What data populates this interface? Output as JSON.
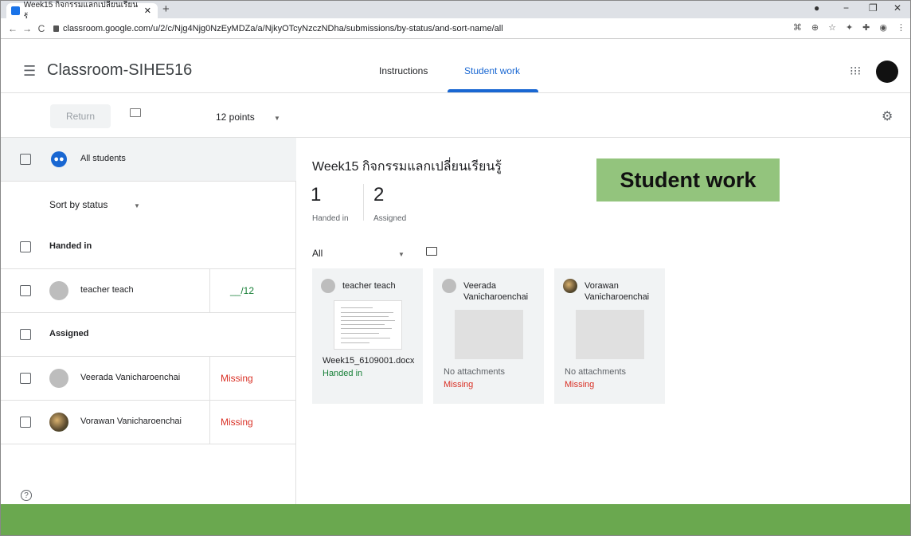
{
  "browser": {
    "tab_title": "Week15 กิจกรรมแลกเปลี่ยนเรียนรู้",
    "url": "classroom.google.com/u/2/c/Njg4Njg0NzEyMDZa/a/NjkyOTcyNzczNDha/submissions/by-status/and-sort-name/all"
  },
  "appbar": {
    "class_name": "Classroom-SIHE516",
    "tabs": [
      "Instructions",
      "Student work"
    ],
    "active_tab": "Student work"
  },
  "toolbar": {
    "return_label": "Return",
    "points": "12 points"
  },
  "roster": {
    "all_students": "All students",
    "sort_label": "Sort by status",
    "handed_in_header": "Handed in",
    "assigned_header": "Assigned",
    "students": [
      {
        "name": "teacher teach",
        "status": "__/12"
      },
      {
        "name": "Veerada Vanicharoenchai",
        "status": "Missing"
      },
      {
        "name": "Vorawan Vanicharoenchai",
        "status": "Missing"
      }
    ]
  },
  "assignment": {
    "title": "Week15 กิจกรรมแลกเปลี่ยนเรียนรู้",
    "handed_in_count": "1",
    "handed_in_label": "Handed in",
    "assigned_count": "2",
    "assigned_label": "Assigned",
    "filter": "All"
  },
  "cards": [
    {
      "name": "teacher teach",
      "file": "Week15_6109001.docx",
      "status": "Handed in"
    },
    {
      "name_line1": "Veerada",
      "name_line2": "Vanicharoenchai",
      "file": "No attachments",
      "status": "Missing"
    },
    {
      "name_line1": "Vorawan",
      "name_line2": "Vanicharoenchai",
      "file": "No attachments",
      "status": "Missing"
    }
  ],
  "banner": "Student work",
  "colors": {
    "accent": "#1967d2",
    "missing": "#d93025",
    "handed": "#188038",
    "banner": "#93c47d",
    "footer": "#6aa84f"
  }
}
